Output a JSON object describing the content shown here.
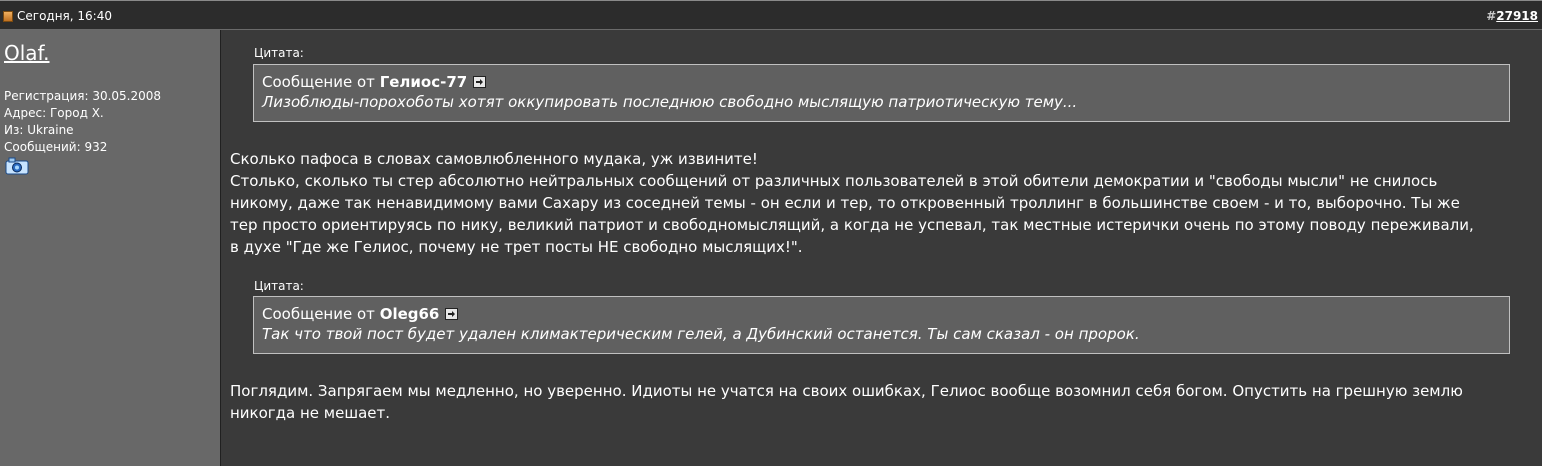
{
  "header": {
    "date": "Сегодня, 16:40",
    "post_hash": "#",
    "post_number": "27918"
  },
  "user": {
    "name": "Olaf.",
    "registration": "Регистрация: 30.05.2008",
    "address": "Адрес: Город Х.",
    "from": "Из: Ukraine",
    "messages": "Сообщений: 932"
  },
  "post": {
    "quote1": {
      "label": "Цитата:",
      "prefix": "Сообщение от",
      "author": "Гелиос-77",
      "text": "Лизоблюды-порохоботы хотят оккупировать последнюю свободно мыслящую патриотическую тему..."
    },
    "paragraph1": [
      "Сколько пафоса в словах самовлюбленного мудака, уж извините!",
      "Столько, сколько ты стер абсолютно нейтральных сообщений от различных пользователей в этой обители демократии и \"свободы мысли\" не снилось",
      "никому, даже так ненавидимому вами Сахару из соседней темы - он если и тер, то откровенный троллинг в большинстве своем - и то, выборочно. Ты же",
      "тер просто ориентируясь по нику, великий патриот и свободномыслящий, а когда не успевал, так местные истерички очень по этому поводу переживали,",
      "в духе \"Где же Гелиос, почему не трет посты НЕ свободно мыслящих!\"."
    ],
    "quote2": {
      "label": "Цитата:",
      "prefix": "Сообщение от",
      "author": "Oleg66",
      "text": "Так что твой пост будет удален климактерическим гелей, а Дубинский останется. Ты сам сказал - он пророк."
    },
    "paragraph2": [
      "Поглядим. Запрягаем мы медленно, но уверенно. Идиоты не учатся на своих ошибках, Гелиос вообще возомнил себя богом. Опустить на грешную землю",
      "никогда не мешает."
    ]
  }
}
